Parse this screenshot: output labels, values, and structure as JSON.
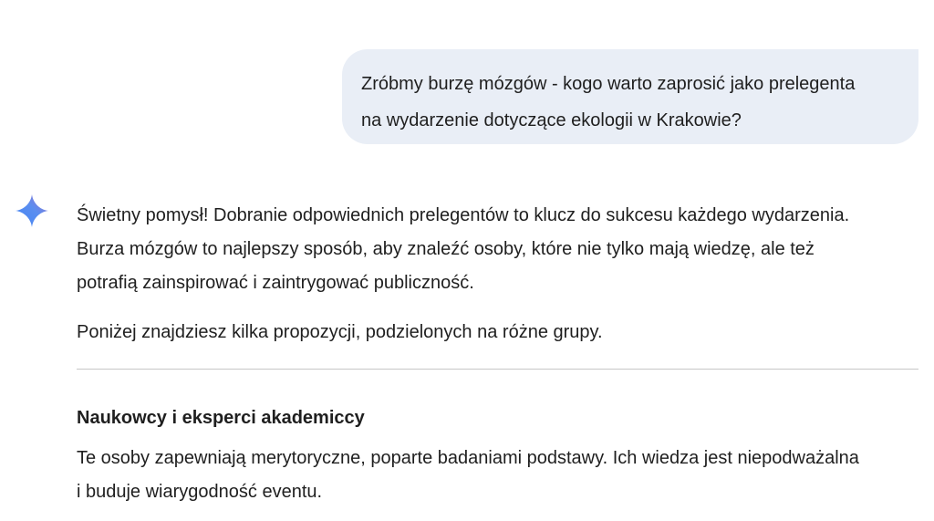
{
  "user_message": {
    "lines": [
      "Zróbmy burzę mózgów - kogo warto zaprosić jako prelegenta",
      "na wydarzenie dotyczące ekologii w Krakowie?"
    ]
  },
  "assistant": {
    "icon": "gemini-sparkle-icon",
    "paragraph_1": [
      "Świetny pomysł! Dobranie odpowiednich prelegentów to klucz do sukcesu każdego wydarzenia.",
      "Burza mózgów to najlepszy sposób, aby znaleźć osoby, które nie tylko mają wiedzę, ale też",
      "potrafią zainspirować i zaintrygować publiczność."
    ],
    "paragraph_2": "Poniżej znajdziesz kilka propozycji, podzielonych na różne grupy.",
    "section_1": {
      "heading": "Naukowcy i eksperci akademiccy",
      "body": [
        "Te osoby zapewniają merytoryczne, poparte badaniami podstawy. Ich wiedza jest niepodważalna",
        "i buduje wiarygodność eventu."
      ]
    }
  },
  "colors": {
    "user_bubble_bg": "#e9eef6",
    "text": "#1f1f1f",
    "divider": "#c7c7c7",
    "sparkle_start": "#4285f4",
    "sparkle_end": "#9b72cb"
  }
}
